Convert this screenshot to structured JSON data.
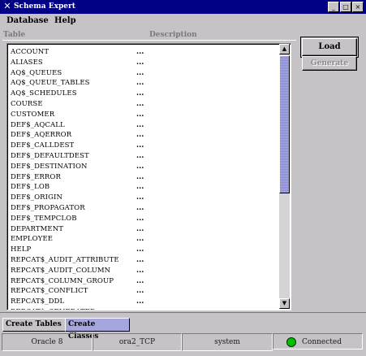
{
  "window": {
    "title": "Schema Expert",
    "icon": "x-logo-icon",
    "controls": [
      "_",
      "□",
      "×"
    ]
  },
  "menu": [
    "Database",
    "Help"
  ],
  "columns": {
    "table": "Table",
    "description": "Description"
  },
  "rows": [
    {
      "name": "ACCOUNT",
      "desc": "..."
    },
    {
      "name": "ALIASES",
      "desc": "..."
    },
    {
      "name": "AQ$_QUEUES",
      "desc": "..."
    },
    {
      "name": "AQ$_QUEUE_TABLES",
      "desc": "..."
    },
    {
      "name": "AQ$_SCHEDULES",
      "desc": "..."
    },
    {
      "name": "COURSE",
      "desc": "..."
    },
    {
      "name": "CUSTOMER",
      "desc": "..."
    },
    {
      "name": "DEF$_AQCALL",
      "desc": "..."
    },
    {
      "name": "DEF$_AQERROR",
      "desc": "..."
    },
    {
      "name": "DEF$_CALLDEST",
      "desc": "..."
    },
    {
      "name": "DEF$_DEFAULTDEST",
      "desc": "..."
    },
    {
      "name": "DEF$_DESTINATION",
      "desc": "..."
    },
    {
      "name": "DEF$_ERROR",
      "desc": "..."
    },
    {
      "name": "DEF$_LOB",
      "desc": "..."
    },
    {
      "name": "DEF$_ORIGIN",
      "desc": "..."
    },
    {
      "name": "DEF$_PROPAGATOR",
      "desc": "..."
    },
    {
      "name": "DEF$_TEMPCLOB",
      "desc": "..."
    },
    {
      "name": "DEPARTMENT",
      "desc": "..."
    },
    {
      "name": "EMPLOYEE",
      "desc": "..."
    },
    {
      "name": "HELP",
      "desc": "..."
    },
    {
      "name": "REPCAT$_AUDIT_ATTRIBUTE",
      "desc": "..."
    },
    {
      "name": "REPCAT$_AUDIT_COLUMN",
      "desc": "..."
    },
    {
      "name": "REPCAT$_COLUMN_GROUP",
      "desc": "..."
    },
    {
      "name": "REPCAT$_CONFLICT",
      "desc": "..."
    },
    {
      "name": "REPCAT$_DDL",
      "desc": "..."
    },
    {
      "name": "REPCAT$_GENERATED",
      "desc": ""
    }
  ],
  "buttons": {
    "load": "Load",
    "generate": "Generate"
  },
  "tabs": [
    "Create Tables",
    "Create Classes"
  ],
  "status": {
    "database": "Oracle 8",
    "service": "ora2_TCP",
    "user": "system",
    "connection": "Connected",
    "connection_color": "#00c000"
  },
  "scroll": {
    "position": 0,
    "visible_fraction": 0.55
  }
}
